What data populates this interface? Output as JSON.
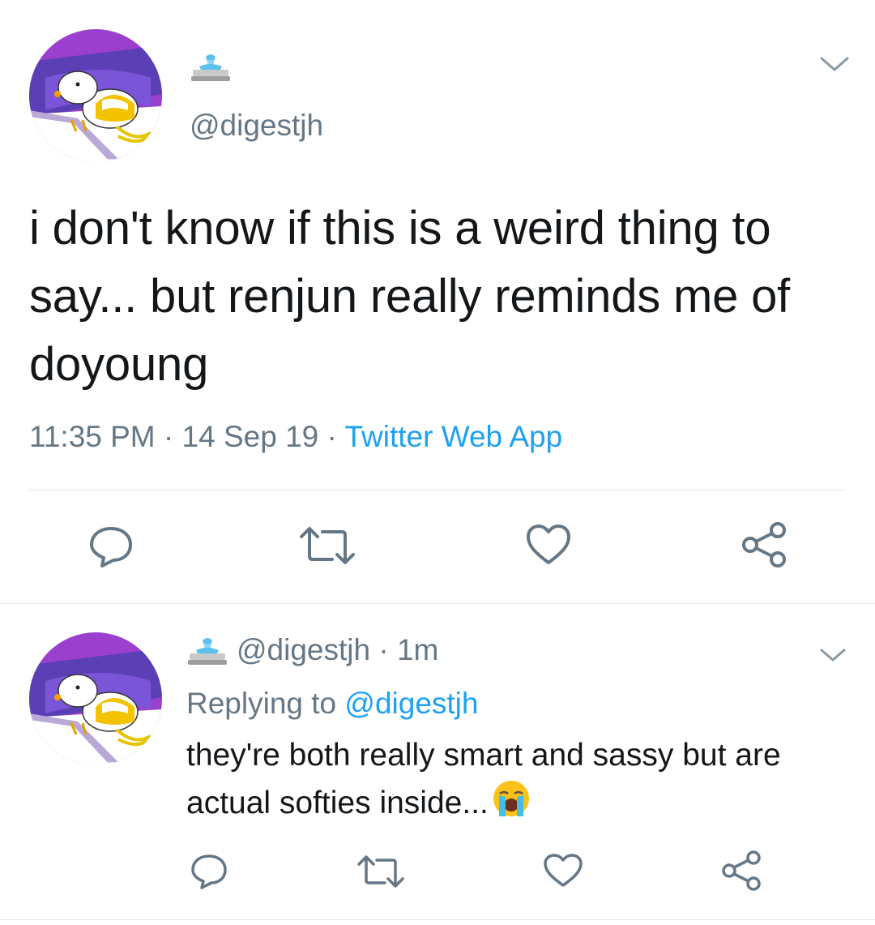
{
  "main_tweet": {
    "handle": "@digestjh",
    "text": "i don't know if this is a weird thing to say... but renjun really reminds me of doyoung",
    "time": "11:35 PM",
    "date": "14 Sep 19",
    "source": "Twitter Web App",
    "separator": "·"
  },
  "actions": {
    "reply_icon": "reply-icon",
    "retweet_icon": "retweet-icon",
    "like_icon": "heart-icon",
    "share_icon": "share-icon"
  },
  "reply_tweet": {
    "handle": "@digestjh",
    "separator": "·",
    "age": "1m",
    "replying_prefix": "Replying to",
    "replying_to": "@digestjh",
    "text": "they're both really smart and sassy but are actual softies inside...",
    "emoji": "loudly-crying-face-emoji"
  },
  "colors": {
    "text": "#14171a",
    "secondary": "#657786",
    "accent": "#1da1f2",
    "divider": "#e1e8ed"
  }
}
